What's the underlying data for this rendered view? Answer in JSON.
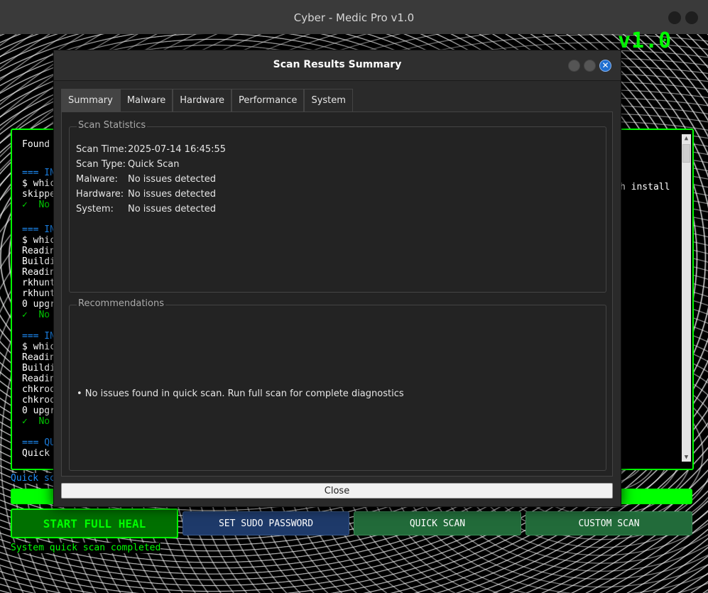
{
  "window": {
    "title": "Cyber - Medic Pro v1.0"
  },
  "app": {
    "heading_visible": "v1.0"
  },
  "log": {
    "lines": [
      {
        "text": "Found ",
        "color": "white"
      },
      {
        "text": "=== IN",
        "color": "blue"
      },
      {
        "text": "$ whic",
        "color": "white"
      },
      {
        "text": "skippe",
        "color": "white"
      },
      {
        "text": "✓  No ",
        "color": "green"
      },
      {
        "text": "=== IN",
        "color": "blue"
      },
      {
        "text": "$ whic",
        "color": "white"
      },
      {
        "text": "Readin",
        "color": "white"
      },
      {
        "text": "Buildi",
        "color": "white"
      },
      {
        "text": "Readin",
        "color": "white"
      },
      {
        "text": "rkhunt",
        "color": "white"
      },
      {
        "text": "rkhunt",
        "color": "white"
      },
      {
        "text": "0 upgr",
        "color": "white"
      },
      {
        "text": "✓  No ",
        "color": "green"
      },
      {
        "text": "=== IN",
        "color": "blue"
      },
      {
        "text": "$ whic",
        "color": "white"
      },
      {
        "text": "Readin",
        "color": "white"
      },
      {
        "text": "Buildi",
        "color": "white"
      },
      {
        "text": "Readin",
        "color": "white"
      },
      {
        "text": "chkroo",
        "color": "white"
      },
      {
        "text": "chkroo",
        "color": "white"
      },
      {
        "text": "0 upgr",
        "color": "white"
      },
      {
        "text": "✓  No ",
        "color": "green"
      },
      {
        "text": "=== QU",
        "color": "blue"
      },
      {
        "text": "Quick ",
        "color": "white"
      }
    ],
    "right_fragment": "h install"
  },
  "status": {
    "scan_message": "Quick scan complete!",
    "progress_percent": 100,
    "footer": "System quick scan completed"
  },
  "buttons": {
    "start_full_heal": "START FULL HEAL",
    "set_sudo_password": "SET SUDO PASSWORD",
    "quick_scan": "QUICK SCAN",
    "custom_scan": "CUSTOM SCAN"
  },
  "dialog": {
    "title": "Scan Results Summary",
    "close_glyph": "✕",
    "tabs": [
      "Summary",
      "Malware",
      "Hardware",
      "Performance",
      "System"
    ],
    "active_tab": "Summary",
    "scan_statistics": {
      "legend": "Scan Statistics",
      "rows": [
        {
          "label": "Scan Time:",
          "value": "2025-07-14 16:45:55"
        },
        {
          "label": "Scan Type:",
          "value": "Quick Scan"
        },
        {
          "label": "Malware:",
          "value": "No issues detected"
        },
        {
          "label": "Hardware:",
          "value": "No issues detected"
        },
        {
          "label": "System:",
          "value": "No issues detected"
        }
      ]
    },
    "recommendations": {
      "legend": "Recommendations",
      "items": [
        "• No issues found in quick scan. Run full scan for complete diagnostics"
      ]
    },
    "close_button": "Close"
  },
  "colors": {
    "accent_green": "#00ff00",
    "log_blue": "#1e90ff",
    "dialog_close_blue": "#1f6fd0"
  }
}
